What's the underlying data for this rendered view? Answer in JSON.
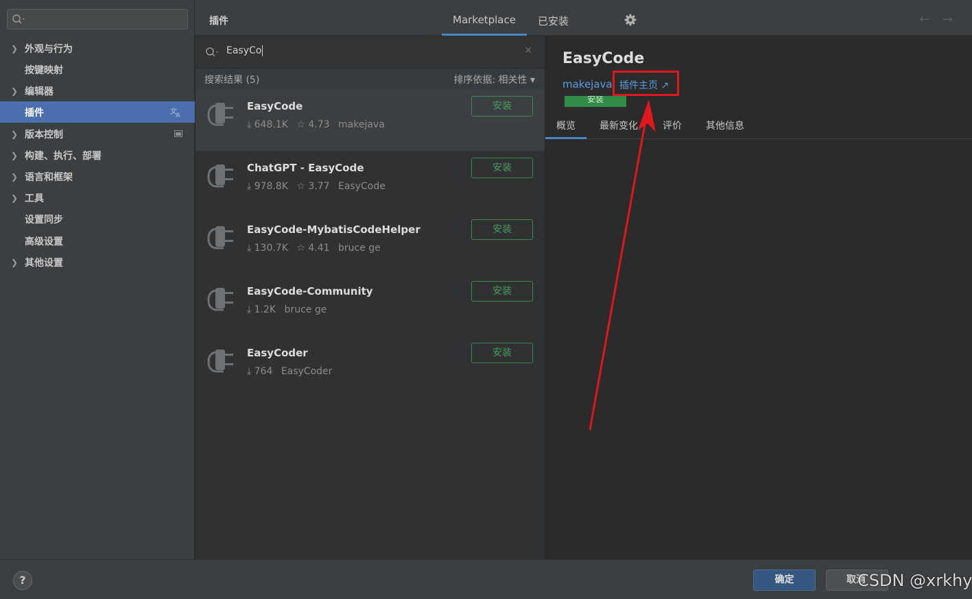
{
  "sidebar": {
    "search_placeholder": "",
    "items": [
      {
        "label": "外观与行为",
        "expandable": true
      },
      {
        "label": "按键映射",
        "expandable": false
      },
      {
        "label": "编辑器",
        "expandable": true
      },
      {
        "label": "插件",
        "expandable": false,
        "selected": true
      },
      {
        "label": "版本控制",
        "expandable": true
      },
      {
        "label": "构建、执行、部署",
        "expandable": true
      },
      {
        "label": "语言和框架",
        "expandable": true
      },
      {
        "label": "工具",
        "expandable": true
      },
      {
        "label": "设置同步",
        "expandable": false
      },
      {
        "label": "高级设置",
        "expandable": false
      },
      {
        "label": "其他设置",
        "expandable": true
      }
    ]
  },
  "header": {
    "title": "插件",
    "tabs": [
      {
        "label": "Marketplace",
        "active": true
      },
      {
        "label": "已安装",
        "active": false
      }
    ],
    "back_arrow": "←",
    "forward_arrow": "→"
  },
  "search": {
    "value": "EasyCo",
    "clear": "✕"
  },
  "results": {
    "count_label": "搜索结果 (5)",
    "sort_label": "排序依据: 相关性 ▾"
  },
  "plugins": [
    {
      "name": "EasyCode",
      "downloads": "⤓ 648.1K",
      "rating": "☆ 4.73",
      "vendor": "makejava",
      "install_label": "安装",
      "selected": true
    },
    {
      "name": "ChatGPT - EasyCode",
      "downloads": "⤓ 978.8K",
      "rating": "☆ 3.77",
      "vendor": "EasyCode",
      "install_label": "安装"
    },
    {
      "name": "EasyCode-MybatisCodeHelper",
      "downloads": "⤓ 130.7K",
      "rating": "☆ 4.41",
      "vendor": "bruce ge",
      "install_label": "安装"
    },
    {
      "name": "EasyCode-Community",
      "downloads": "⤓ 1.2K",
      "rating": "",
      "vendor": "bruce ge",
      "install_label": "安装"
    },
    {
      "name": "EasyCoder",
      "downloads": "⤓ 764",
      "rating": "",
      "vendor": "EasyCoder",
      "install_label": "安装"
    }
  ],
  "detail": {
    "name": "EasyCode",
    "vendor": "makejava",
    "homepage_label": "插件主页 ↗",
    "install_label": "安装",
    "tabs": [
      {
        "label": "概览",
        "active": true
      },
      {
        "label": "最新变化",
        "active": false
      },
      {
        "label": "评价",
        "active": false
      },
      {
        "label": "其他信息",
        "active": false
      }
    ]
  },
  "footer": {
    "help": "?",
    "ok_label": "确定",
    "cancel_label": "取消",
    "watermark": "CSDN @xrkhy"
  },
  "colors": {
    "accent": "#4b6eaf",
    "link": "#5a9ce0",
    "install_green": "#489a5d",
    "annotation_red": "#e0171d"
  }
}
